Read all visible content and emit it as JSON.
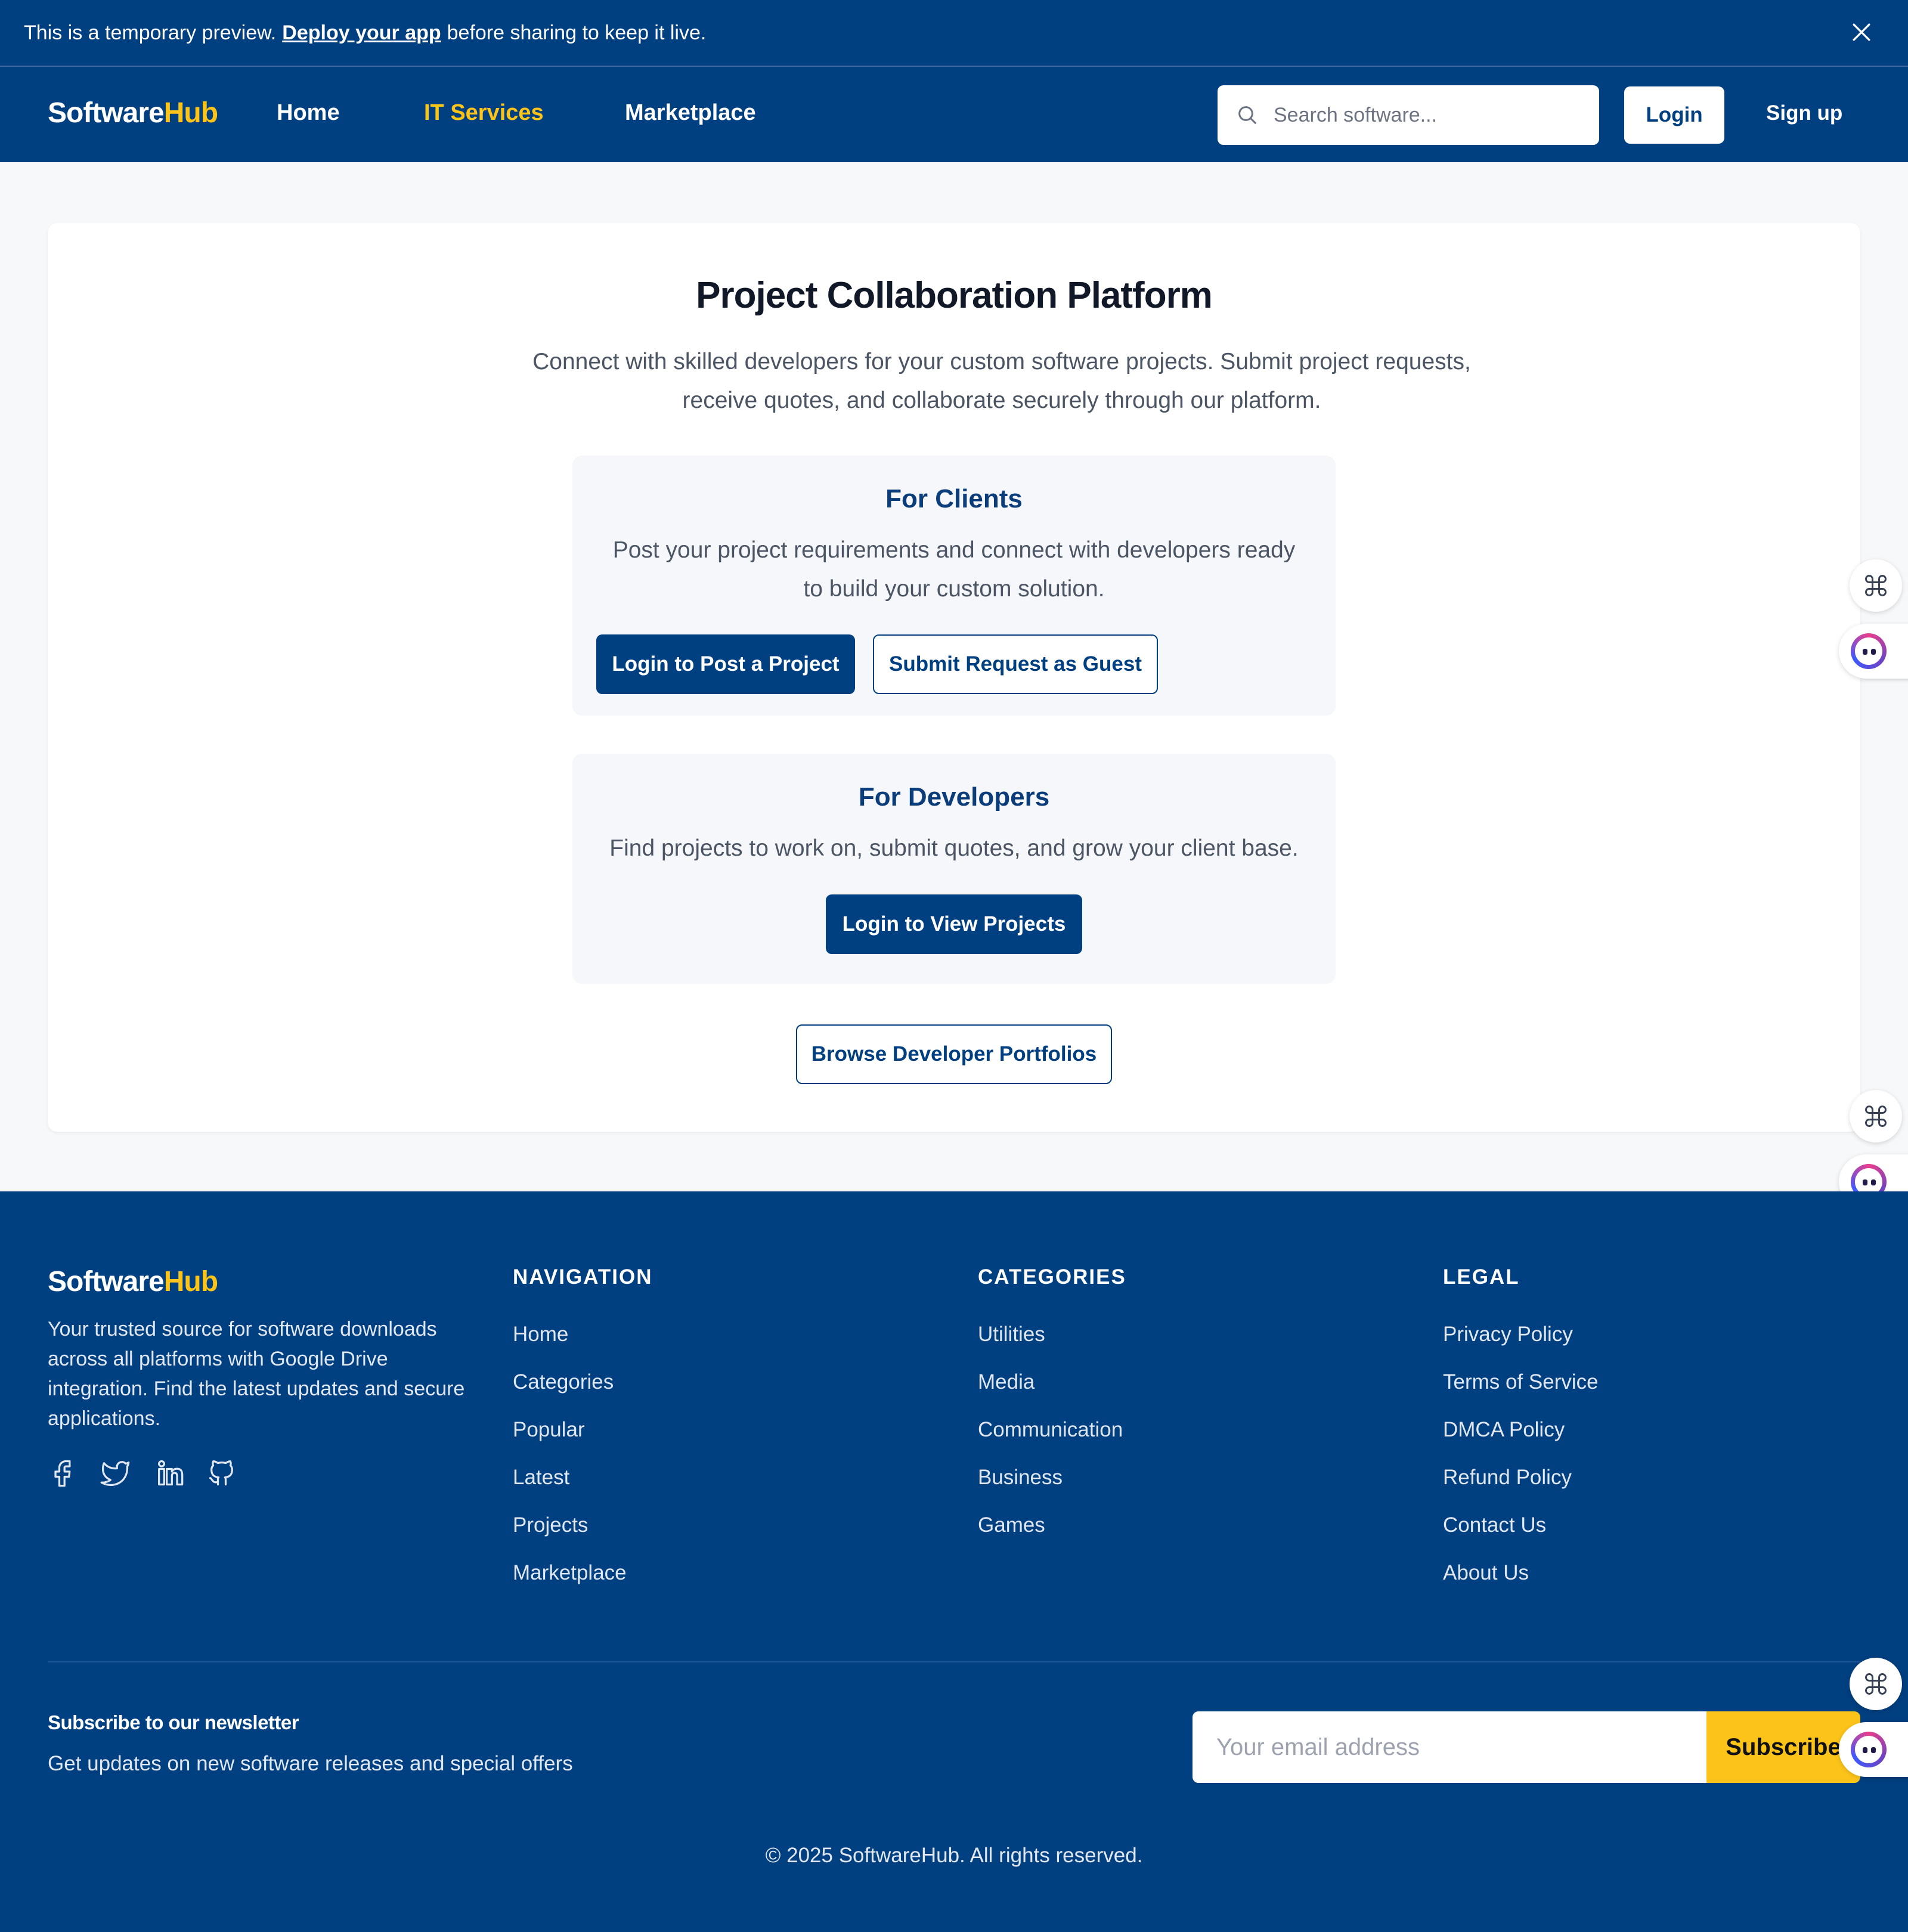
{
  "banner": {
    "text_before": "This is a temporary preview.",
    "link": "Deploy your app",
    "text_after": "before sharing to keep it live."
  },
  "header": {
    "logo_part1": "Software",
    "logo_part2": "Hub",
    "nav": [
      {
        "label": "Home",
        "active": false
      },
      {
        "label": "IT Services",
        "active": true
      },
      {
        "label": "Marketplace",
        "active": false
      }
    ],
    "search_placeholder": "Search software...",
    "login": "Login",
    "signup": "Sign up"
  },
  "main": {
    "title": "Project Collaboration Platform",
    "intro_line1": "Connect with skilled developers for your custom software projects. Submit project requests,",
    "intro_line2": "receive quotes, and collaborate securely through our platform.",
    "clients": {
      "title": "For Clients",
      "line1": "Post your project requirements and connect with developers ready",
      "line2": "to build your custom solution.",
      "primary_button": "Login to Post a Project",
      "secondary_button": "Submit Request as Guest"
    },
    "developers": {
      "title": "For Developers",
      "text": "Find projects to work on, submit quotes, and grow your client base.",
      "button": "Login to View Projects"
    },
    "browse_button": "Browse Developer Portfolios"
  },
  "footer": {
    "logo_part1": "Software",
    "logo_part2": "Hub",
    "about": "Your trusted source for software downloads across all platforms with Google Drive integration. Find the latest updates and secure applications.",
    "social": [
      "facebook-icon",
      "twitter-icon",
      "linkedin-icon",
      "github-icon"
    ],
    "columns": [
      {
        "title": "NAVIGATION",
        "links": [
          "Home",
          "Categories",
          "Popular",
          "Latest",
          "Projects",
          "Marketplace"
        ]
      },
      {
        "title": "CATEGORIES",
        "links": [
          "Utilities",
          "Media",
          "Communication",
          "Business",
          "Games"
        ]
      },
      {
        "title": "LEGAL",
        "links": [
          "Privacy Policy",
          "Terms of Service",
          "DMCA Policy",
          "Refund Policy",
          "Contact Us",
          "About Us"
        ]
      }
    ],
    "newsletter_title": "Subscribe to our newsletter",
    "newsletter_sub": "Get updates on new software releases and special offers",
    "email_placeholder": "Your email address",
    "subscribe": "Subscribe",
    "copyright": "© 2025 SoftwareHub. All rights reserved."
  },
  "colors": {
    "primary": "#003f80",
    "accent": "#fcc419",
    "background": "#f7f8fa",
    "panel": "#f5f7fa"
  }
}
